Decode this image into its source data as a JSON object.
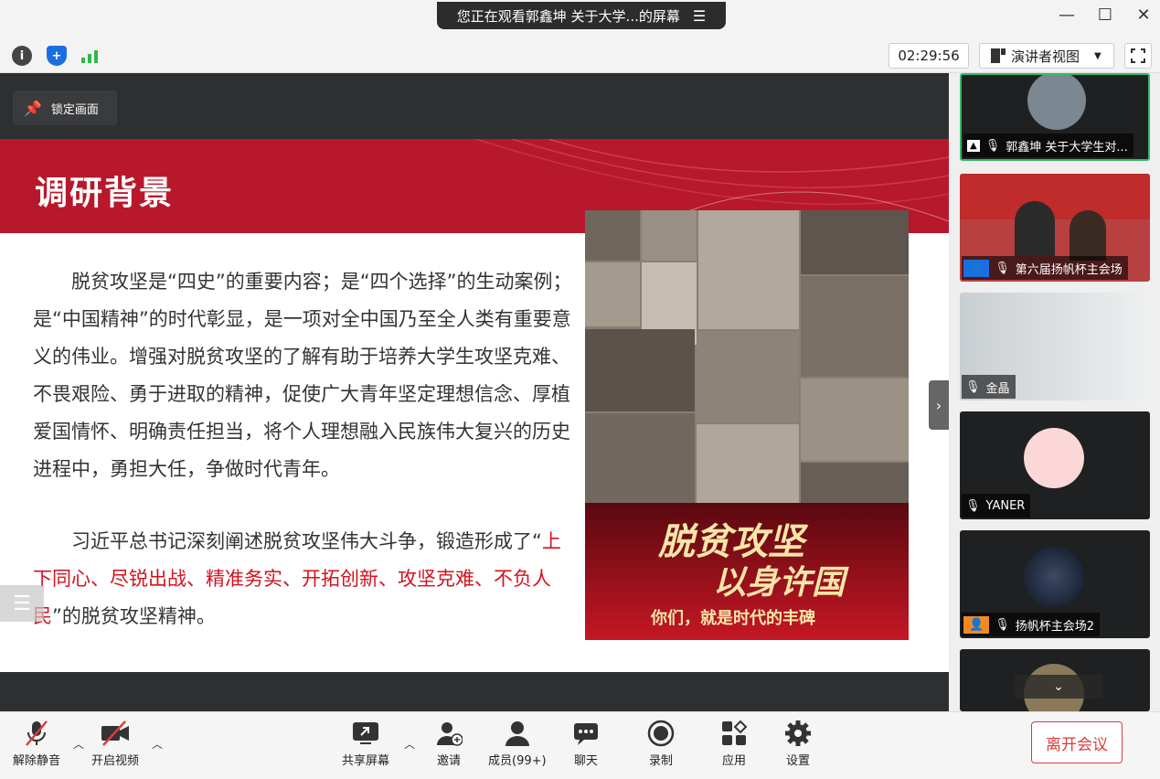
{
  "share_banner": {
    "text": "您正在观看郭鑫坤 关于大学...的屏幕",
    "menu_icon": "list-icon"
  },
  "window_controls": {
    "minimize": "—",
    "maximize": "☐",
    "close": "✕"
  },
  "toolbar": {
    "timer": "02:29:56",
    "view_mode": "演讲者视图",
    "icons": [
      "info-icon",
      "shield-icon",
      "signal-icon"
    ]
  },
  "stage": {
    "lock_label": "锁定画面"
  },
  "slide": {
    "title": "调研背景",
    "para1": "脱贫攻坚是“四史”的重要内容；是“四个选择”的生动案例；是“中国精神”的时代彰显，是一项对全中国乃至全人类有重要意义的伟业。增强对脱贫攻坚的了解有助于培养大学生攻坚克难、不畏艰险、勇于进取的精神，促使广大青年坚定理想信念、厚植爱国情怀、明确责任担当，将个人理想融入民族伟大复兴的历史进程中，勇担大任，争做时代青年。",
    "para2_start": "习近平总书记深刻阐述脱贫攻坚伟大斗争，锻造形成了“",
    "para2_red": "上下同心、尽锐出战、精准务实、开拓创新、攻坚克难、不负人民",
    "para2_end": "”的脱贫攻坚精神。",
    "poster_line1": "脱贫攻坚",
    "poster_line2": "以身许国",
    "poster_line3": "你们，就是时代的丰碑"
  },
  "participants": [
    {
      "name": "郭鑫坤 关于大学生对..."
    },
    {
      "name": "第六届扬帆杯主会场"
    },
    {
      "name": "金晶"
    },
    {
      "name": "YANER"
    },
    {
      "name": "扬帆杯主会场2"
    }
  ],
  "bottom": {
    "unmute": "解除静音",
    "start_video": "开启视频",
    "share_screen": "共享屏幕",
    "invite": "邀请",
    "members": "成员(99+)",
    "chat": "聊天",
    "record": "录制",
    "apps": "应用",
    "settings": "设置",
    "leave": "离开会议"
  },
  "colors": {
    "accent_red": "#b8182b",
    "text_red": "#d4121f"
  }
}
